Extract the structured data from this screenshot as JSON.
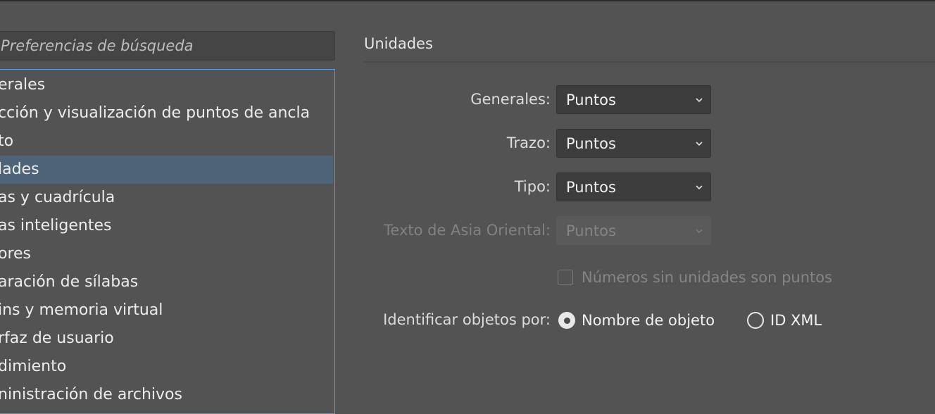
{
  "search": {
    "placeholder": "Preferencias de búsqueda"
  },
  "sidebar": {
    "items": [
      {
        "label": "erales",
        "selected": false
      },
      {
        "label": "cción y visualización de puntos de ancla",
        "selected": false
      },
      {
        "label": "to",
        "selected": false
      },
      {
        "label": "lades",
        "selected": true
      },
      {
        "label": "as y cuadrícula",
        "selected": false
      },
      {
        "label": "as inteligentes",
        "selected": false
      },
      {
        "label": "ores",
        "selected": false
      },
      {
        "label": "aración de sílabas",
        "selected": false
      },
      {
        "label": "ins y memoria virtual",
        "selected": false
      },
      {
        "label": "rfaz de usuario",
        "selected": false
      },
      {
        "label": "dimiento",
        "selected": false
      },
      {
        "label": "ninistración de archivos",
        "selected": false
      }
    ]
  },
  "panel": {
    "title": "Unidades",
    "rows": [
      {
        "label": "Generales:",
        "value": "Puntos",
        "disabled": false
      },
      {
        "label": "Trazo:",
        "value": "Puntos",
        "disabled": false
      },
      {
        "label": "Tipo:",
        "value": "Puntos",
        "disabled": false
      },
      {
        "label": "Texto de Asia Oriental:",
        "value": "Puntos",
        "disabled": true
      }
    ],
    "checkbox": {
      "label": "Números sin unidades son puntos",
      "checked": false,
      "disabled": true
    },
    "identify": {
      "label": "Identificar objetos por:",
      "options": [
        {
          "label": "Nombre de objeto",
          "checked": true
        },
        {
          "label": "ID XML",
          "checked": false
        }
      ]
    }
  }
}
